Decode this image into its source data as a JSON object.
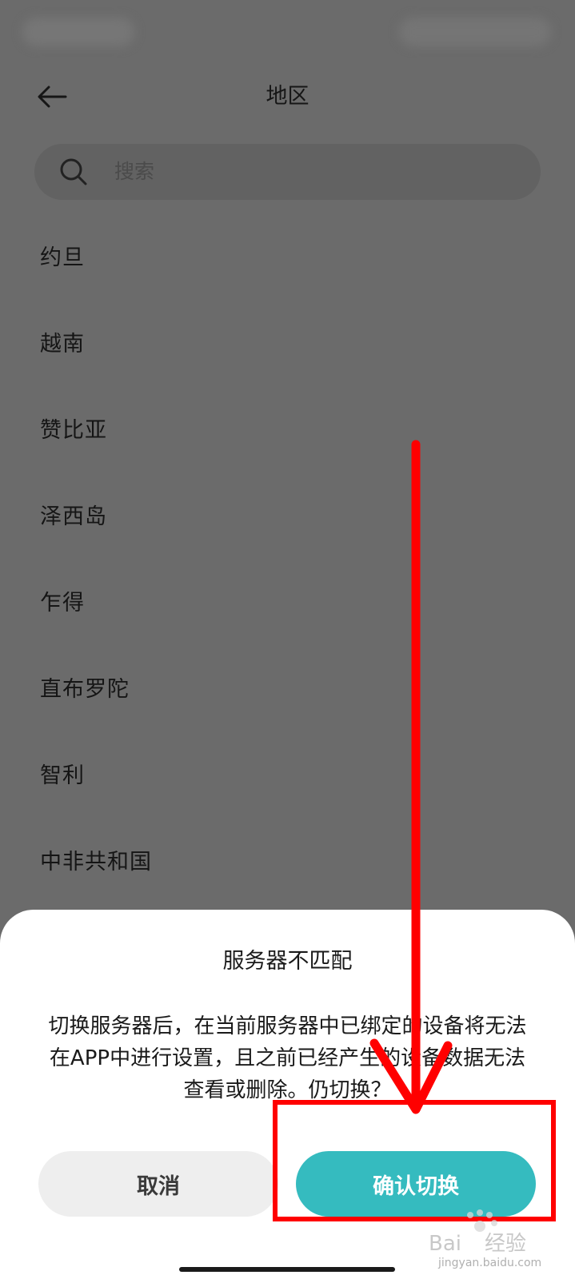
{
  "header": {
    "title": "地区"
  },
  "search": {
    "placeholder": "搜索"
  },
  "regions": [
    "约旦",
    "越南",
    "赞比亚",
    "泽西岛",
    "乍得",
    "直布罗陀",
    "智利",
    "中非共和国"
  ],
  "dialog": {
    "title": "服务器不匹配",
    "message": "切换服务器后，在当前服务器中已绑定的设备将无法在APP中进行设置，且之前已经产生的设备数据无法查看或删除。仍切换？",
    "cancel_label": "取消",
    "confirm_label": "确认切换"
  },
  "watermark": {
    "logo_text": "Baidu经验",
    "url": "jingyan.baidu.com"
  },
  "colors": {
    "accent": "#35bbbf",
    "annotation": "#ff0000",
    "overlay": "#6b6b6b"
  }
}
